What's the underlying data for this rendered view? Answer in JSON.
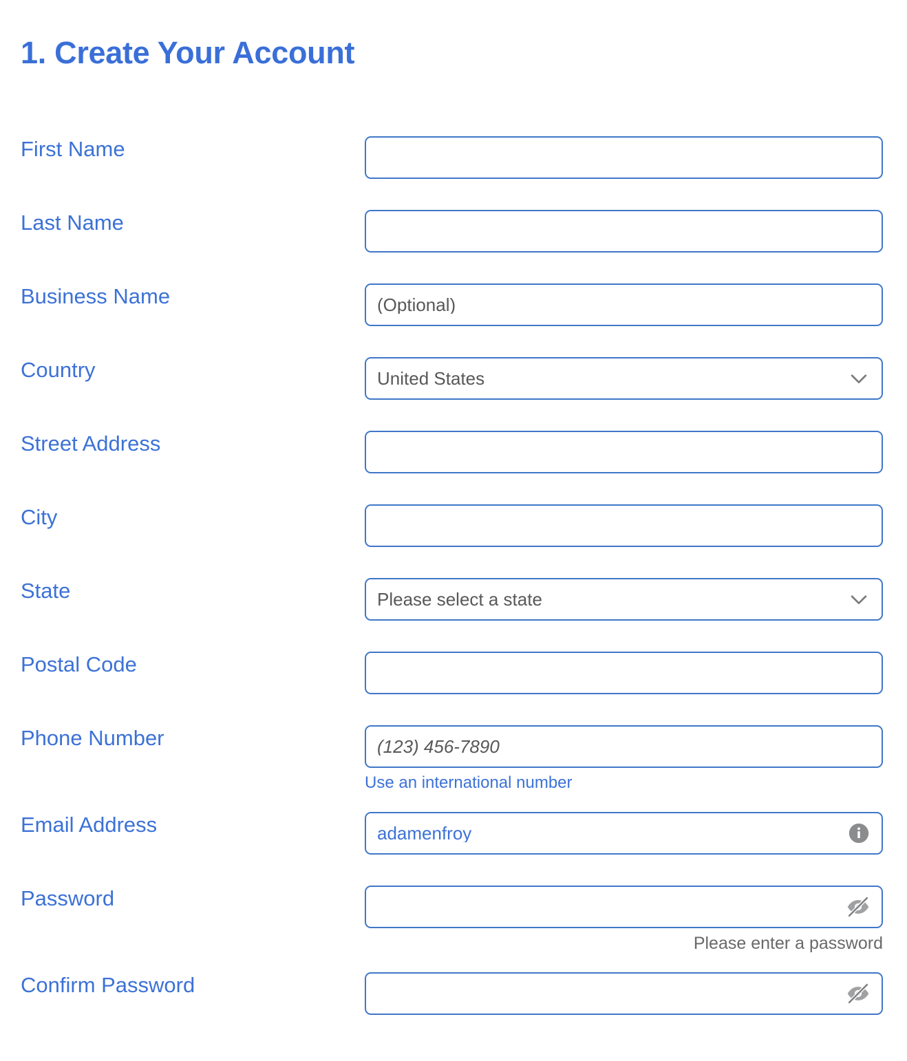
{
  "page": {
    "title": "1. Create Your Account",
    "title_color": "#3a6fd8",
    "label_color": "#3c72d6",
    "border_color": "#3f77c9",
    "placeholder_color": "#58585a",
    "help_color": "#68696b",
    "background": "#ffffff"
  },
  "form": {
    "fields": [
      {
        "label": "First Name",
        "type": "text",
        "value": "",
        "placeholder": "",
        "help": null
      },
      {
        "label": "Last Name",
        "type": "text",
        "value": "",
        "placeholder": "",
        "help": null
      },
      {
        "label": "Business Name",
        "type": "text",
        "value": "",
        "placeholder": "(Optional)",
        "help": null
      },
      {
        "label": "Country",
        "type": "select",
        "value": "United States",
        "placeholder": "",
        "help": null,
        "icon": "chevron-down-icon"
      },
      {
        "label": "Street Address",
        "type": "text",
        "value": "",
        "placeholder": "",
        "help": null
      },
      {
        "label": "City",
        "type": "text",
        "value": "",
        "placeholder": "",
        "help": null
      },
      {
        "label": "State",
        "type": "select",
        "value": "Please select a state",
        "placeholder": "Please select a state",
        "help": null,
        "icon": "chevron-down-icon"
      },
      {
        "label": "Postal Code",
        "type": "text",
        "value": "",
        "placeholder": "",
        "help": null
      },
      {
        "label": "Phone Number",
        "type": "tel",
        "value": "",
        "placeholder": "(123) 456-7890",
        "help": "Use an international number",
        "help_kind": "link"
      },
      {
        "label": "Email Address",
        "type": "email",
        "value": "adamenfroy",
        "placeholder": "",
        "help": null,
        "icon": "info-icon"
      },
      {
        "label": "Password",
        "type": "password",
        "value": "",
        "placeholder": "",
        "help": "Please enter a password",
        "help_kind": "note",
        "icon": "eye-off-icon"
      },
      {
        "label": "Confirm Password",
        "type": "password",
        "value": "",
        "placeholder": "",
        "help": null,
        "icon": "eye-off-icon"
      }
    ]
  }
}
